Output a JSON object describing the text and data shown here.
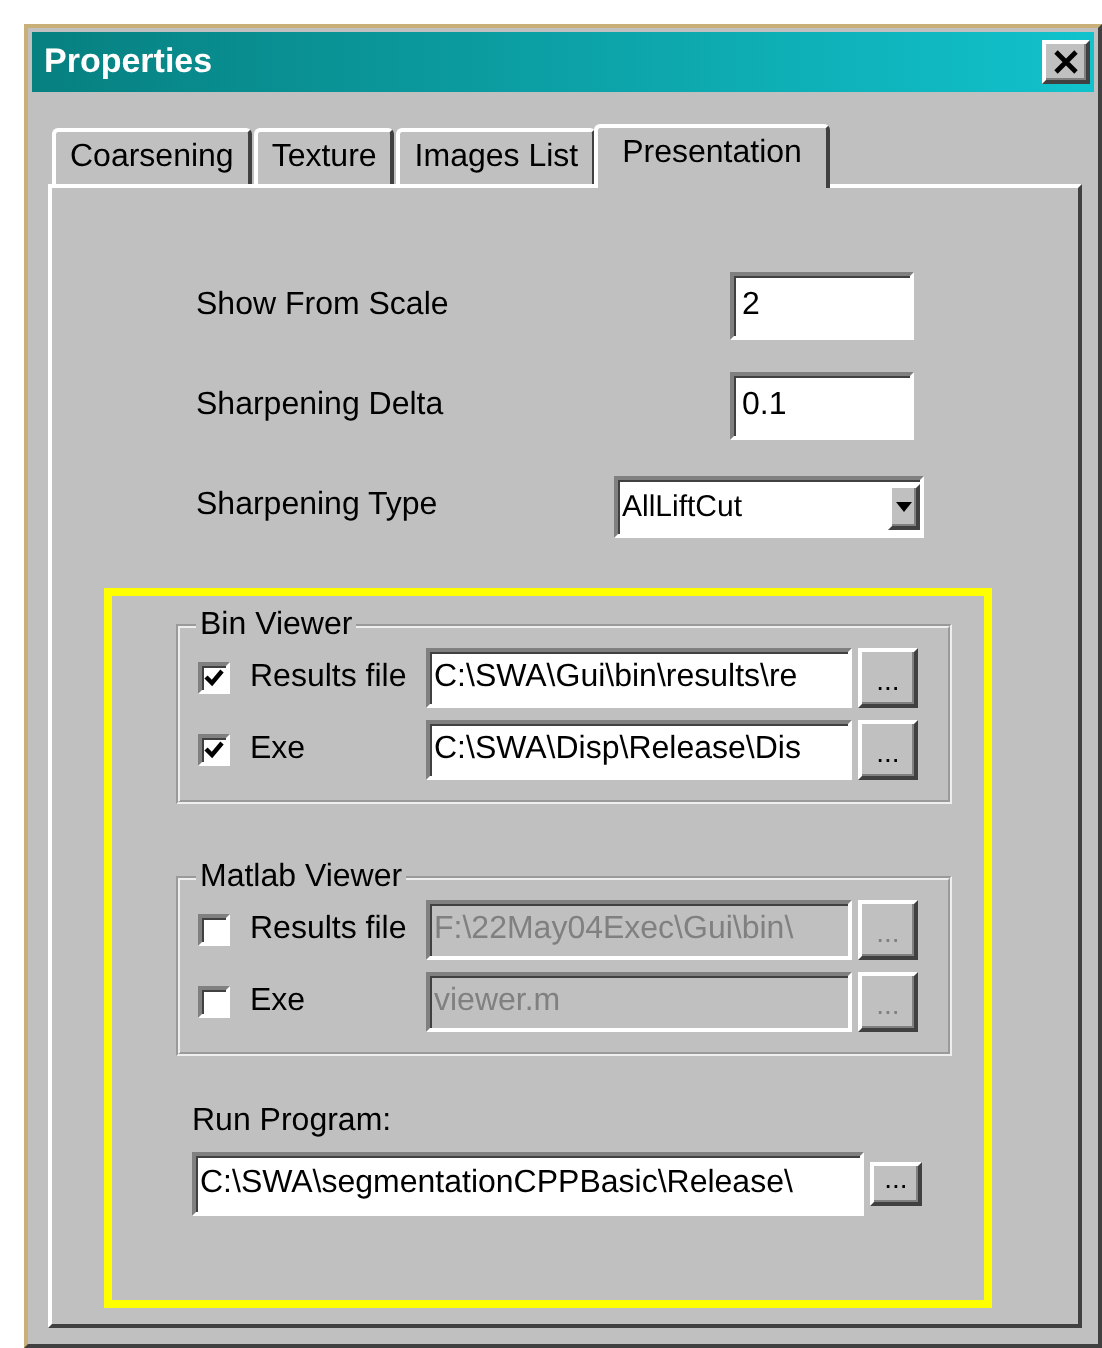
{
  "window": {
    "title": "Properties"
  },
  "tabs": [
    {
      "label": "Coarsening",
      "selected": false
    },
    {
      "label": "Texture",
      "selected": false
    },
    {
      "label": "Images List",
      "selected": false
    },
    {
      "label": "Presentation",
      "selected": true
    }
  ],
  "fields": [
    {
      "label": "Show From Scale",
      "kind": "text",
      "value": "2"
    },
    {
      "label": "Sharpening Delta",
      "kind": "text",
      "value": "0.1"
    },
    {
      "label": "Sharpening Type",
      "kind": "combo",
      "value": "AllLiftCut"
    }
  ],
  "groups": [
    {
      "title": "Bin Viewer",
      "rows": [
        {
          "label": "Results file",
          "checked": true,
          "disabled": false,
          "value": "C:\\SWA\\Gui\\bin\\results\\re",
          "browse": "..."
        },
        {
          "label": "Exe",
          "checked": true,
          "disabled": false,
          "value": "C:\\SWA\\Disp\\Release\\Dis",
          "browse": "..."
        }
      ]
    },
    {
      "title": "Matlab Viewer",
      "rows": [
        {
          "label": "Results file",
          "checked": false,
          "disabled": true,
          "value": "F:\\22May04Exec\\Gui\\bin\\",
          "browse": "..."
        },
        {
          "label": "Exe",
          "checked": false,
          "disabled": true,
          "value": "viewer.m",
          "browse": "..."
        }
      ]
    }
  ],
  "run_program": {
    "label": "Run Program:",
    "value": "C:\\SWA\\segmentationCPPBasic\\Release\\",
    "browse": "..."
  }
}
